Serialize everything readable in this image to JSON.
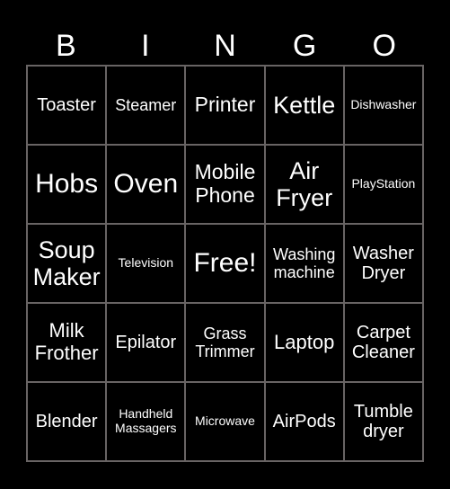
{
  "header": [
    "B",
    "I",
    "N",
    "G",
    "O"
  ],
  "colors": {
    "background": "#000000",
    "text": "#ffffff",
    "grid_line": "#686464"
  },
  "cells": [
    [
      {
        "text": "Toaster",
        "size": "m"
      },
      {
        "text": "Steamer",
        "size": "sm"
      },
      {
        "text": "Printer",
        "size": "l"
      },
      {
        "text": "Kettle",
        "size": "xl"
      },
      {
        "text": "Dishwasher",
        "size": "xs"
      }
    ],
    [
      {
        "text": "Hobs",
        "size": "xxl"
      },
      {
        "text": "Oven",
        "size": "xxl"
      },
      {
        "text": "Mobile Phone",
        "size": "l"
      },
      {
        "text": "Air Fryer",
        "size": "xl"
      },
      {
        "text": "PlayStation",
        "size": "xs"
      }
    ],
    [
      {
        "text": "Soup Maker",
        "size": "xl"
      },
      {
        "text": "Television",
        "size": "xs"
      },
      {
        "text": "Free!",
        "size": "xxl"
      },
      {
        "text": "Washing machine",
        "size": "sm"
      },
      {
        "text": "Washer Dryer",
        "size": "m"
      }
    ],
    [
      {
        "text": "Milk Frother",
        "size": "ml"
      },
      {
        "text": "Epilator",
        "size": "m"
      },
      {
        "text": "Grass Trimmer",
        "size": "sm"
      },
      {
        "text": "Laptop",
        "size": "ml"
      },
      {
        "text": "Carpet Cleaner",
        "size": "m"
      }
    ],
    [
      {
        "text": "Blender",
        "size": "m"
      },
      {
        "text": "Handheld Massagers",
        "size": "xs"
      },
      {
        "text": "Microwave",
        "size": "xs"
      },
      {
        "text": "AirPods",
        "size": "m"
      },
      {
        "text": "Tumble dryer",
        "size": "m"
      }
    ]
  ]
}
